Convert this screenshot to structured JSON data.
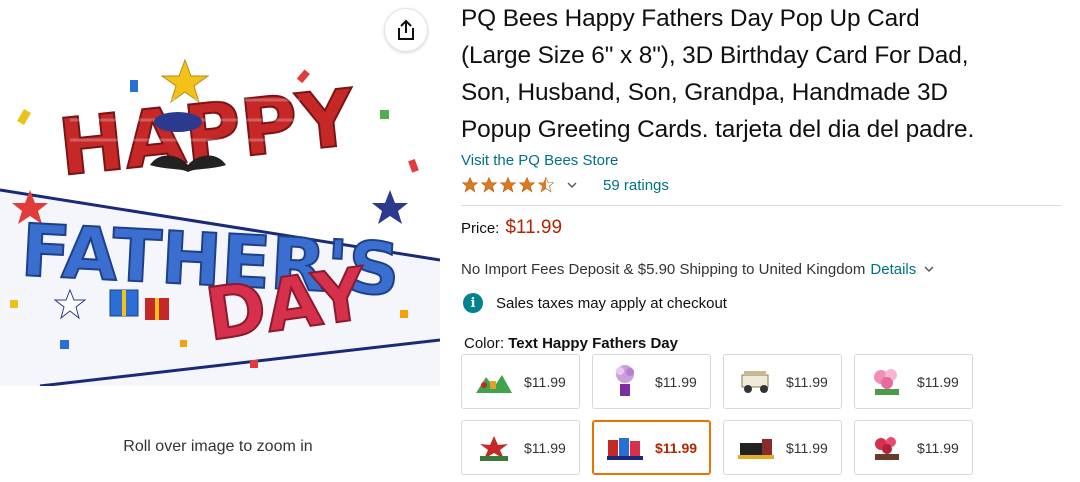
{
  "product": {
    "title": "PQ Bees Happy Fathers Day Pop Up Card (Large Size 6\" x 8\"), 3D Birthday Card For Dad, Son, Husband, Son, Grandpa, Handmade 3D Popup Greeting Cards. tarjeta del dia del padre.",
    "title_lines": [
      "PQ Bees Happy Fathers Day Pop Up Card",
      "(Large Size 6\" x 8\"), 3D Birthday Card For Dad,",
      "Son, Husband, Son, Grandpa, Handmade 3D",
      "Popup Greeting Cards. tarjeta del dia del padre."
    ],
    "store_link": "Visit the PQ Bees Store",
    "rating_stars": 4.5,
    "ratings_count": "59 ratings"
  },
  "image": {
    "zoom_hint": "Roll over image to zoom in",
    "main_image_alt": "Pop up card with 3D letters HAPPY FATHER'S DAY",
    "card_letters": {
      "line1": "HAPPY",
      "line2": "FATHER'S",
      "line3": "DAY"
    }
  },
  "pricing": {
    "label": "Price:",
    "value": "$11.99"
  },
  "shipping": {
    "text": "No Import Fees Deposit & $5.90 Shipping to United Kingdom",
    "details_link": "Details"
  },
  "tax": {
    "text": "Sales taxes may apply at checkout"
  },
  "color": {
    "label": "Color:",
    "selected": "Text Happy Fathers Day"
  },
  "swatches": [
    {
      "price": "$11.99",
      "icon": "landscape-card-thumb",
      "selected": false
    },
    {
      "price": "$11.99",
      "icon": "flower-vase-card-thumb",
      "selected": false
    },
    {
      "price": "$11.99",
      "icon": "golf-cart-card-thumb",
      "selected": false
    },
    {
      "price": "$11.99",
      "icon": "pink-flowers-card-thumb",
      "selected": false
    },
    {
      "price": "$11.99",
      "icon": "red-poinsettia-card-thumb",
      "selected": false
    },
    {
      "price": "$11.99",
      "icon": "fathers-day-card-thumb",
      "selected": true
    },
    {
      "price": "$11.99",
      "icon": "train-card-thumb",
      "selected": false
    },
    {
      "price": "$11.99",
      "icon": "red-blossom-card-thumb",
      "selected": false
    }
  ],
  "colors": {
    "link": "#007185",
    "price": "#b12704",
    "star": "#de7921",
    "selected_border": "#e77600",
    "info": "#00838f"
  }
}
